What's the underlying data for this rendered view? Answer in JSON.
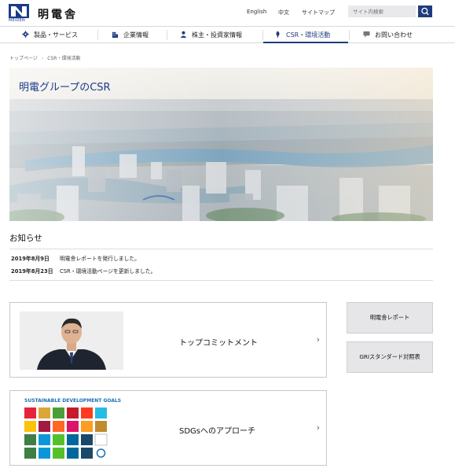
{
  "header": {
    "logo_text": "MEIDEN",
    "brand": "明電舎",
    "util_links": [
      "English",
      "中文",
      "サイトマップ"
    ],
    "search_placeholder": "サイト内検索"
  },
  "nav": {
    "items": [
      {
        "label": "製品・サービス",
        "icon": "gear-icon"
      },
      {
        "label": "企業情報",
        "icon": "building-icon"
      },
      {
        "label": "株主・投資家情報",
        "icon": "person-icon"
      },
      {
        "label": "CSR・環境活動",
        "icon": "leaf-icon",
        "active": true
      },
      {
        "label": "お問い合わせ",
        "icon": "chat-icon"
      }
    ]
  },
  "breadcrumb": [
    "トップページ",
    "CSR・環境活動"
  ],
  "hero": {
    "title": "明電グループのCSR"
  },
  "news": {
    "heading": "お知らせ",
    "items": [
      {
        "date": "2019年8月9日",
        "text": "明電舎レポートを発行しました。"
      },
      {
        "date": "2019年8月23日",
        "text": "CSR・環境活動ページを更新しました。"
      }
    ]
  },
  "cards": [
    {
      "label": "トップコミットメント",
      "chevron": "›"
    },
    {
      "label": "SDGsへのアプローチ",
      "chevron": "›"
    }
  ],
  "sdgs": {
    "title": "SUSTAINABLE DEVELOPMENT GOALS"
  },
  "side_buttons": [
    "明電舎レポート",
    "GRIスタンダード対照表"
  ],
  "colors": {
    "brand": "#1e3c7d",
    "hero_title": "#1a3a8c"
  }
}
